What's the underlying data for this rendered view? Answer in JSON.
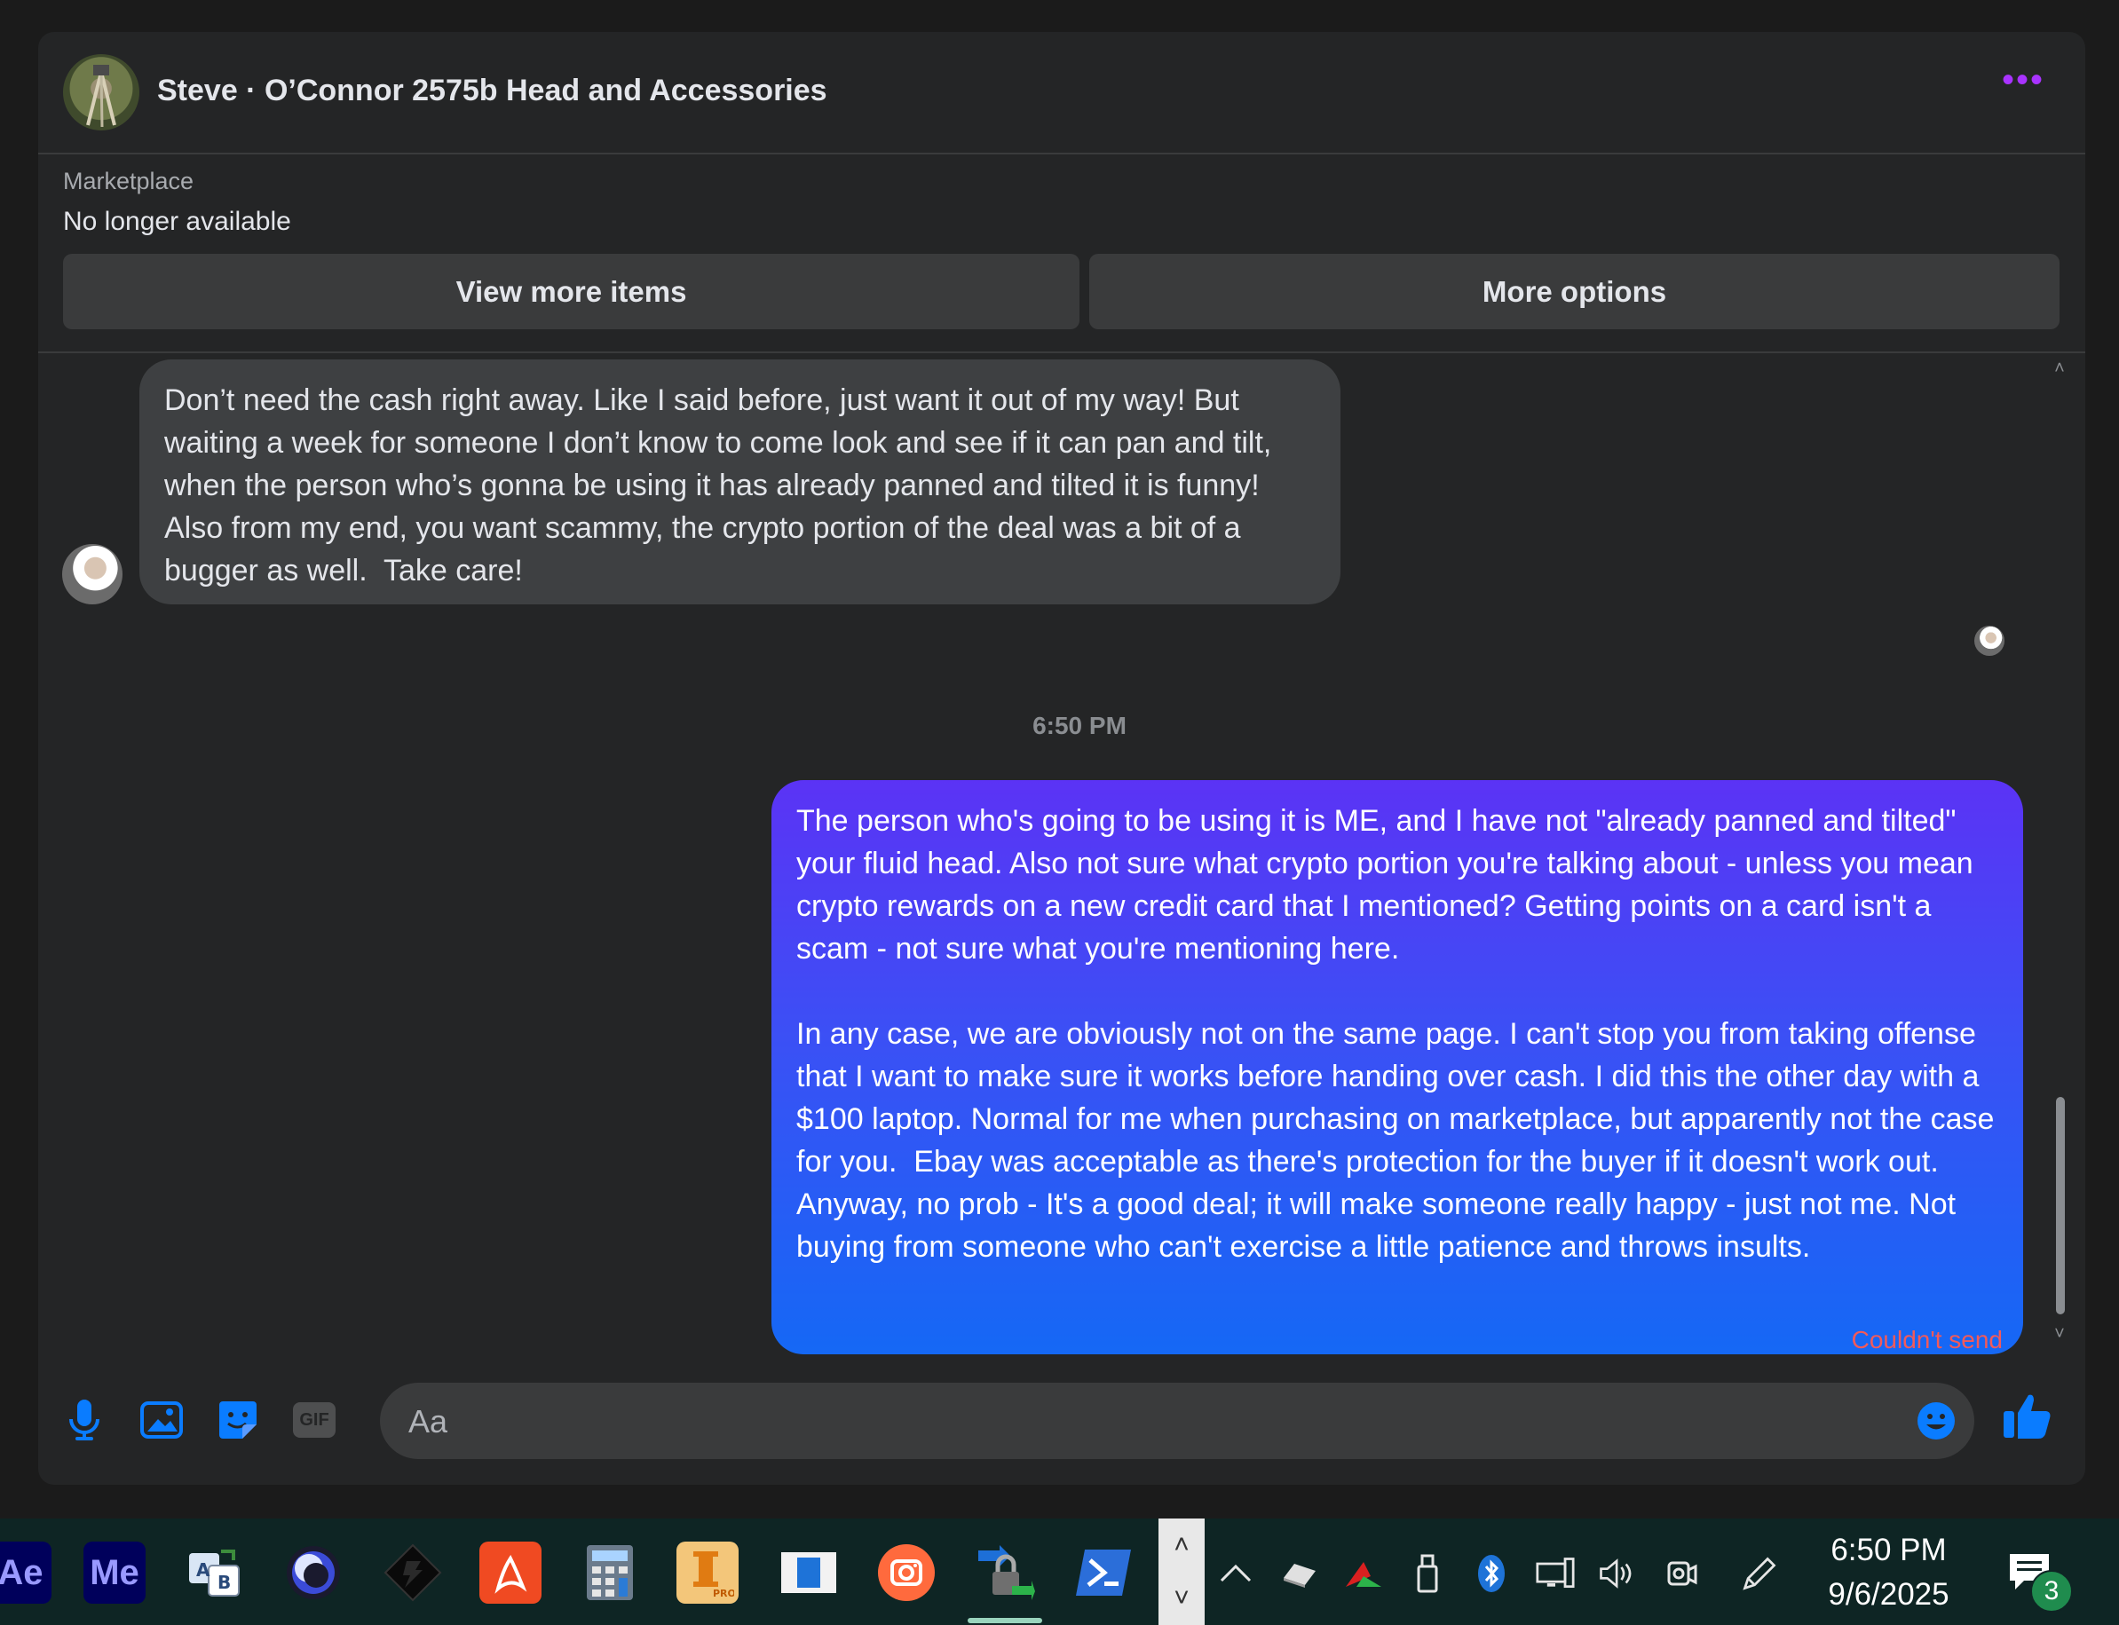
{
  "header": {
    "title": "Steve · O’Connor 2575b Head and Accessories",
    "more_icon": "more-dots-icon"
  },
  "marketplace": {
    "label": "Marketplace",
    "status": "No longer available",
    "view_more_label": "View more items",
    "more_options_label": "More options"
  },
  "messages": {
    "incoming_text": "Don’t need the cash right away. Like I said before, just want it out of my way! But waiting a week for someone I don’t know to come look and see if it can pan and tilt, when the person who’s gonna be using it has already panned and tilted it is funny! Also from my end, you want scammy, the crypto portion of the deal was a bit of a bugger as well.  Take care!",
    "timestamp": "6:50 PM",
    "outgoing_text": "The person who's going to be using it is ME, and I have not \"already panned and tilted\" your fluid head. Also not sure what crypto portion you're talking about - unless you mean crypto rewards on a new credit card that I mentioned? Getting points on a card isn't a scam - not sure what you're mentioning here.\n\nIn any case, we are obviously not on the same page. I can't stop you from taking offense that I want to make sure it works before handing over cash. I did this the other day with a $100 laptop. Normal for me when purchasing on marketplace, but apparently not the case for you.  Ebay was acceptable as there's protection for the buyer if it doesn't work out. Anyway, no prob - It's a good deal; it will make someone really happy - just not me. Not buying from someone who can't exercise a little patience and throws insults.",
    "failed_status": "Couldn't send"
  },
  "composer": {
    "placeholder": "Aa",
    "gif_label": "GIF"
  },
  "taskbar": {
    "apps": [
      {
        "name": "after-effects",
        "label": "Ae",
        "bg": "#00005b",
        "fg": "#9999ff"
      },
      {
        "name": "media-encoder",
        "label": "Me",
        "bg": "#00005b",
        "fg": "#9999ff"
      }
    ],
    "time": "6:50 PM",
    "date": "9/6/2025",
    "notification_count": "3"
  },
  "colors": {
    "accent": "#0a7cff",
    "failed": "#f25a5a",
    "bubble_in": "#3e4042"
  }
}
